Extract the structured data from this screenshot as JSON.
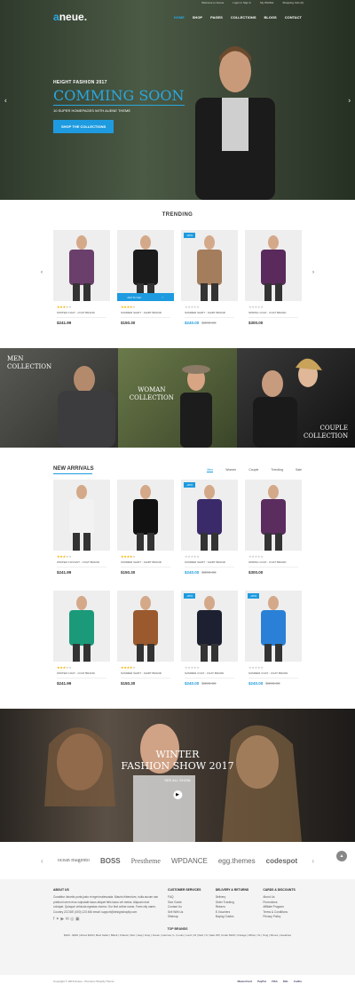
{
  "topbar": {
    "welcome": "Welcome to Aneue",
    "login": "Login or Sign in",
    "wishlist": "My Wishlist",
    "cart": "Shopping Cart (0)"
  },
  "logo": {
    "main": "aneue",
    "accent": "a"
  },
  "menu": [
    "HOME",
    "SHOP",
    "PAGES",
    "COLLECTIONS",
    "BLOGS",
    "CONTACT"
  ],
  "hero": {
    "sub": "HEIGHT FASHION 2017",
    "title": "COMMING SOON",
    "desc": "10 SUPER HOMEPAGES WITH AUENE THEME",
    "button": "SHOP THE COLLECTIONS"
  },
  "trending": {
    "title": "TRENDING",
    "products": [
      {
        "name": "WINTER COAT - COAT BRAND",
        "price": "$241.99",
        "old": "",
        "stars": 3,
        "badge": ""
      },
      {
        "name": "SUMMER SHIRT - SHIRT BRAND",
        "price": "$150.30",
        "old": "",
        "stars": 4,
        "badge": "",
        "cart": "Add To Cart"
      },
      {
        "name": "SUMMER SHIRT - SHIRT BRAND",
        "price": "$240.00",
        "old": "$300.00",
        "stars": 0,
        "badge": "-20%"
      },
      {
        "name": "SPRING COAT - COAT BRAND",
        "price": "$300.00",
        "old": "",
        "stars": 0,
        "badge": ""
      }
    ]
  },
  "collections": [
    {
      "label": "MEN COLLECTION"
    },
    {
      "label": "WOMAN COLLECTION"
    },
    {
      "label": "COUPLE COLLECTION"
    }
  ],
  "arrivals": {
    "title": "NEW ARRIVALS",
    "tabs": [
      "Men",
      "Women",
      "Couple",
      "Trending",
      "Sale"
    ],
    "row1": [
      {
        "name": "WINTER COVIANT - COAT BRAND",
        "price": "$241.99",
        "old": "",
        "stars": 3,
        "badge": ""
      },
      {
        "name": "SUMMER SHIRT - SHIRT BRAND",
        "price": "$150.30",
        "old": "",
        "stars": 4,
        "badge": ""
      },
      {
        "name": "SUMMER SHIRT - SHIRT BRAND",
        "price": "$240.00",
        "old": "$300.00",
        "stars": 0,
        "badge": "-20%"
      },
      {
        "name": "SPRING COAT - COAT BRAND",
        "price": "$300.00",
        "old": "",
        "stars": 0,
        "badge": ""
      }
    ],
    "row2": [
      {
        "name": "WINTER COAT - COAT BRAND",
        "price": "$241.99",
        "old": "",
        "stars": 3,
        "badge": ""
      },
      {
        "name": "SUMMER SHIRT - SHIRT BRAND",
        "price": "$150.30",
        "old": "",
        "stars": 4,
        "badge": ""
      },
      {
        "name": "SUMMER COAT - COAT BRAND",
        "price": "$240.00",
        "old": "$300.00",
        "stars": 0,
        "badge": "-20%"
      },
      {
        "name": "SUMMER COAT - COAT BRAND",
        "price": "$240.00",
        "old": "$300.00",
        "stars": 0,
        "badge": "-20%"
      }
    ]
  },
  "fashion": {
    "line1": "WINTER",
    "line2": "FASHION SHOW 2017",
    "sub": "SEE ALL SHOW"
  },
  "brands": [
    "ocean magento",
    "BOSS",
    "Prestheme",
    "WPDANCE",
    "egg.themes",
    "codespot"
  ],
  "footer": {
    "about_title": "ABOUT US",
    "about_text": "Curabitur lobortis porta justo et eget malesuada. Mauris bibendum, nulla accum san pretium lorem eros vulputate lacus aliquet felis lacus vel metus. Aliquam erat volutpat. Quisque vehicula egestas viverra. Our first online name, Farm city name, Country ZCODE (000) 123 456 email: support@designshopify.com",
    "services_title": "CUSTOMER SERVICES",
    "services": [
      "FAQ",
      "Size Guide",
      "Contact Us",
      "Sell With Us",
      "Sitemap"
    ],
    "delivery_title": "DELIVERY & RETURNS",
    "delivery": [
      "Delivery",
      "Order Tracking",
      "Returns",
      "E-Vouchers",
      "Buying Guides"
    ],
    "cards_title": "CARDS & DISCOUNTS",
    "cards": [
      "About Us",
      "Promotions",
      "Affiliate Program",
      "Terms & Conditions",
      "Privacy Policy"
    ],
    "top_brands_title": "TOP BRANDS",
    "top_brands": "$100 - $200 | About $100 | Best Seller | Black | Chanel | Dior | Gap | Gray | Green | Hermes | L | Louis | Lucci | M | Red | S | Sale Off | Under $100 | Vintage | White | XL | Smg | Shoes | Jewelries",
    "copyright": "Copyright © 2016 Aneue - Premium Shopify Theme",
    "payments": [
      "MasterCard",
      "PayPal",
      "VISA",
      "DHL",
      "FedEx"
    ]
  }
}
